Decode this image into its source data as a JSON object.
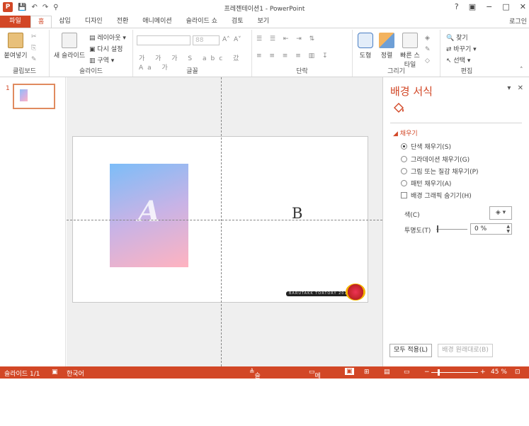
{
  "window": {
    "title": "프레젠테이션1 - PowerPoint",
    "help": "?",
    "ribbon_display": "▣",
    "minimize": "−",
    "restore": "□",
    "close": "✕",
    "login": "로그인"
  },
  "qat": {
    "logo": "P",
    "save": "💾",
    "undo": "↶",
    "redo": "↷",
    "customize": "⚲"
  },
  "tabs": [
    "파일",
    "홈",
    "삽입",
    "디자인",
    "전환",
    "애니메이션",
    "슬라이드 쇼",
    "검토",
    "보기"
  ],
  "ribbon": {
    "clipboard": {
      "paste": "붙여넣기",
      "label": "클립보드"
    },
    "slides": {
      "new_slide": "새 슬라이드",
      "layout": "레이아웃",
      "reset": "다시 설정",
      "section": "구역",
      "label": "슬라이드"
    },
    "font": {
      "size": "88",
      "label": "글꼴"
    },
    "paragraph": {
      "label": "단락"
    },
    "drawing": {
      "shapes": "도형",
      "arrange": "정렬",
      "quick_styles": "빠른 스타일",
      "label": "그리기"
    },
    "editing": {
      "find": "찾기",
      "replace": "바꾸기",
      "select": "선택",
      "label": "편집"
    }
  },
  "slides_panel": {
    "number": "1"
  },
  "slide": {
    "letter_a": "A",
    "letter_b": "B",
    "stamp_text": "BARUTAKK TORTORY 2018"
  },
  "format_pane": {
    "title": "배경 서식",
    "section": "채우기",
    "options": [
      "단색 채우기(S)",
      "그라데이션 채우기(G)",
      "그림 또는 질감 채우기(P)",
      "패턴 채우기(A)"
    ],
    "selected_index": 0,
    "hide_graphics": "배경 그래픽 숨기기(H)",
    "color_label": "색(C)",
    "transparency_label": "투명도(T)",
    "transparency_value": "0 %",
    "apply_all": "모두 적용(L)",
    "reset_background": "배경 원래대로(B)"
  },
  "statusbar": {
    "slide": "슬라이드 1/1",
    "language": "한국어",
    "notes": "슬라이드 노트",
    "comments": "메모",
    "zoom": "45 %"
  }
}
